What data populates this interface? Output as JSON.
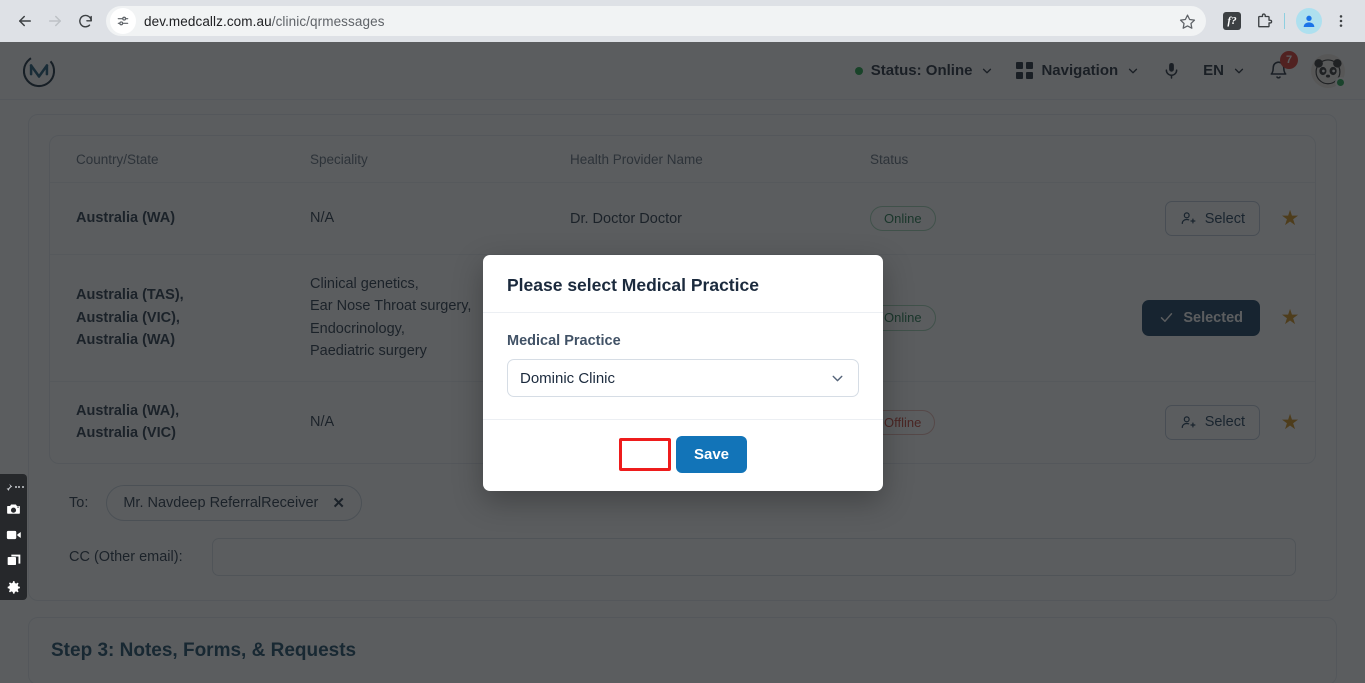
{
  "browser": {
    "url_main": "dev.medcallz.com.au",
    "url_path": "/clinic/qrmessages",
    "back_icon": "back-arrow-icon",
    "forward_icon": "forward-arrow-icon",
    "reload_icon": "reload-icon",
    "site_info_icon": "site-settings-icon",
    "bookmark_icon": "star-icon",
    "extension_label": "f?",
    "puzzle_icon": "extensions-puzzle-icon",
    "profile_icon": "profile-avatar-icon",
    "menu_icon": "three-dot-menu-icon"
  },
  "app_header": {
    "logo_name": "medcallz-logo",
    "status_label": "Status: Online",
    "status_color": "#15a33f",
    "navigation_label": "Navigation",
    "mic_icon": "microphone-icon",
    "language_label": "EN",
    "notifications_count": "7",
    "notifications_icon": "bell-icon",
    "avatar_name": "user-avatar"
  },
  "table": {
    "columns": [
      "Country/State",
      "Speciality",
      "Health Provider Name",
      "Status"
    ],
    "rows": [
      {
        "country": "Australia (WA)",
        "speciality": "N/A",
        "provider": "Dr. Doctor Doctor",
        "status": "Online",
        "status_type": "online",
        "action": "Select",
        "action_type": "select",
        "star": "★"
      },
      {
        "country": "Australia (TAS),\nAustralia (VIC),\nAustralia (WA)",
        "speciality": "Clinical genetics,\nEar Nose Throat surgery,\nEndocrinology,\nPaediatric surgery",
        "provider": "",
        "status": "Online",
        "status_type": "online",
        "action": "Selected",
        "action_type": "selected",
        "star": "★"
      },
      {
        "country": "Australia (WA),\nAustralia (VIC)",
        "speciality": "N/A",
        "provider": "",
        "status": "Offline",
        "status_type": "offline",
        "action": "Select",
        "action_type": "select",
        "star": "★"
      }
    ]
  },
  "recipients": {
    "to_label": "To:",
    "to_chip": "Mr. Navdeep ReferralReceiver",
    "chip_remove": "✕",
    "cc_label": "CC (Other email):",
    "cc_value": "",
    "cc_placeholder": ""
  },
  "step": {
    "title": "Step 3: Notes, Forms, & Requests"
  },
  "modal": {
    "title": "Please select Medical Practice",
    "field_label": "Medical Practice",
    "select_value": "Dominic Clinic",
    "chevron_icon": "chevron-down-icon",
    "cancel_label": "",
    "save_label": "Save",
    "save_color": "#1274b8",
    "highlight_color": "#ee1c1c"
  },
  "recorder_toolbar": {
    "handle_icon": "drag-handle-icon",
    "items": [
      {
        "icon": "screenshot-camera-icon"
      },
      {
        "icon": "video-record-icon"
      },
      {
        "icon": "window-capture-icon"
      },
      {
        "icon": "settings-gear-icon"
      }
    ]
  }
}
